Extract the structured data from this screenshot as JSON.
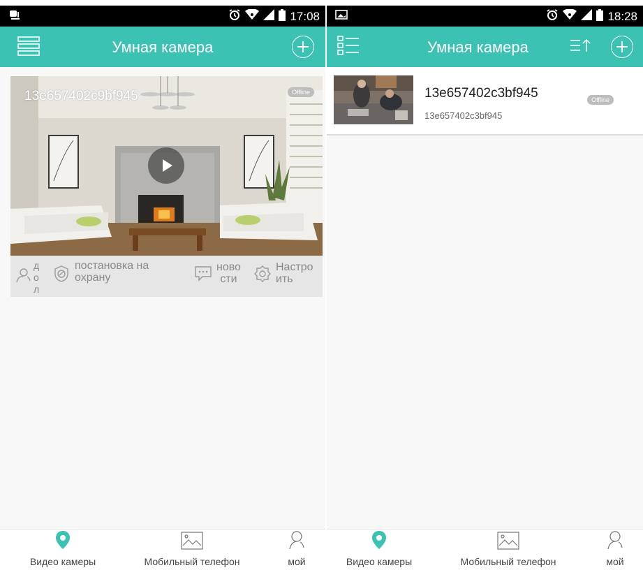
{
  "colors": {
    "accent": "#3cc2b3",
    "statusbar": "#000000",
    "badge": "#bdbdbd"
  },
  "left_screen": {
    "status": {
      "time": "17:08",
      "left_icon": "notification-icon",
      "icons": [
        "alarm-icon",
        "wifi-icon",
        "signal-icon",
        "battery-icon"
      ]
    },
    "header": {
      "title": "Умная камера",
      "left_icon": "menu-list-icon",
      "right_icon": "add-circle-icon"
    },
    "camera_card": {
      "name": "13e657402c9bf945",
      "status_badge": "Offline",
      "play_icon": "play-icon",
      "actions": [
        {
          "icon": "person-icon",
          "label": "д\nо\nл"
        },
        {
          "icon": "shield-icon",
          "label": "постановка на\nохрану"
        },
        {
          "icon": "message-icon",
          "label": "ново\nсти"
        },
        {
          "icon": "settings-icon",
          "label": "Настро\nить"
        }
      ]
    },
    "tabs": [
      {
        "label": "Видео камеры",
        "icon": "location-pin-icon",
        "active": true
      },
      {
        "label": "Мобильный телефон",
        "icon": "image-icon",
        "active": false
      },
      {
        "label": "мой",
        "icon": "user-icon",
        "active": false
      }
    ]
  },
  "right_screen": {
    "status": {
      "time": "18:28",
      "left_icon": "image-notification-icon",
      "icons": [
        "alarm-icon",
        "wifi-icon",
        "signal-icon",
        "battery-icon"
      ]
    },
    "header": {
      "title": "Умная камера",
      "left_icon": "list-view-icon",
      "sort_icon": "sort-icon",
      "right_icon": "add-circle-icon"
    },
    "camera_row": {
      "name": "13e657402c3bf945",
      "id": "13e657402c3bf945",
      "status_badge": "Offline"
    },
    "tabs": [
      {
        "label": "Видео камеры",
        "icon": "location-pin-icon",
        "active": true
      },
      {
        "label": "Мобильный телефон",
        "icon": "image-icon",
        "active": false
      },
      {
        "label": "мой",
        "icon": "user-icon",
        "active": false
      }
    ]
  }
}
